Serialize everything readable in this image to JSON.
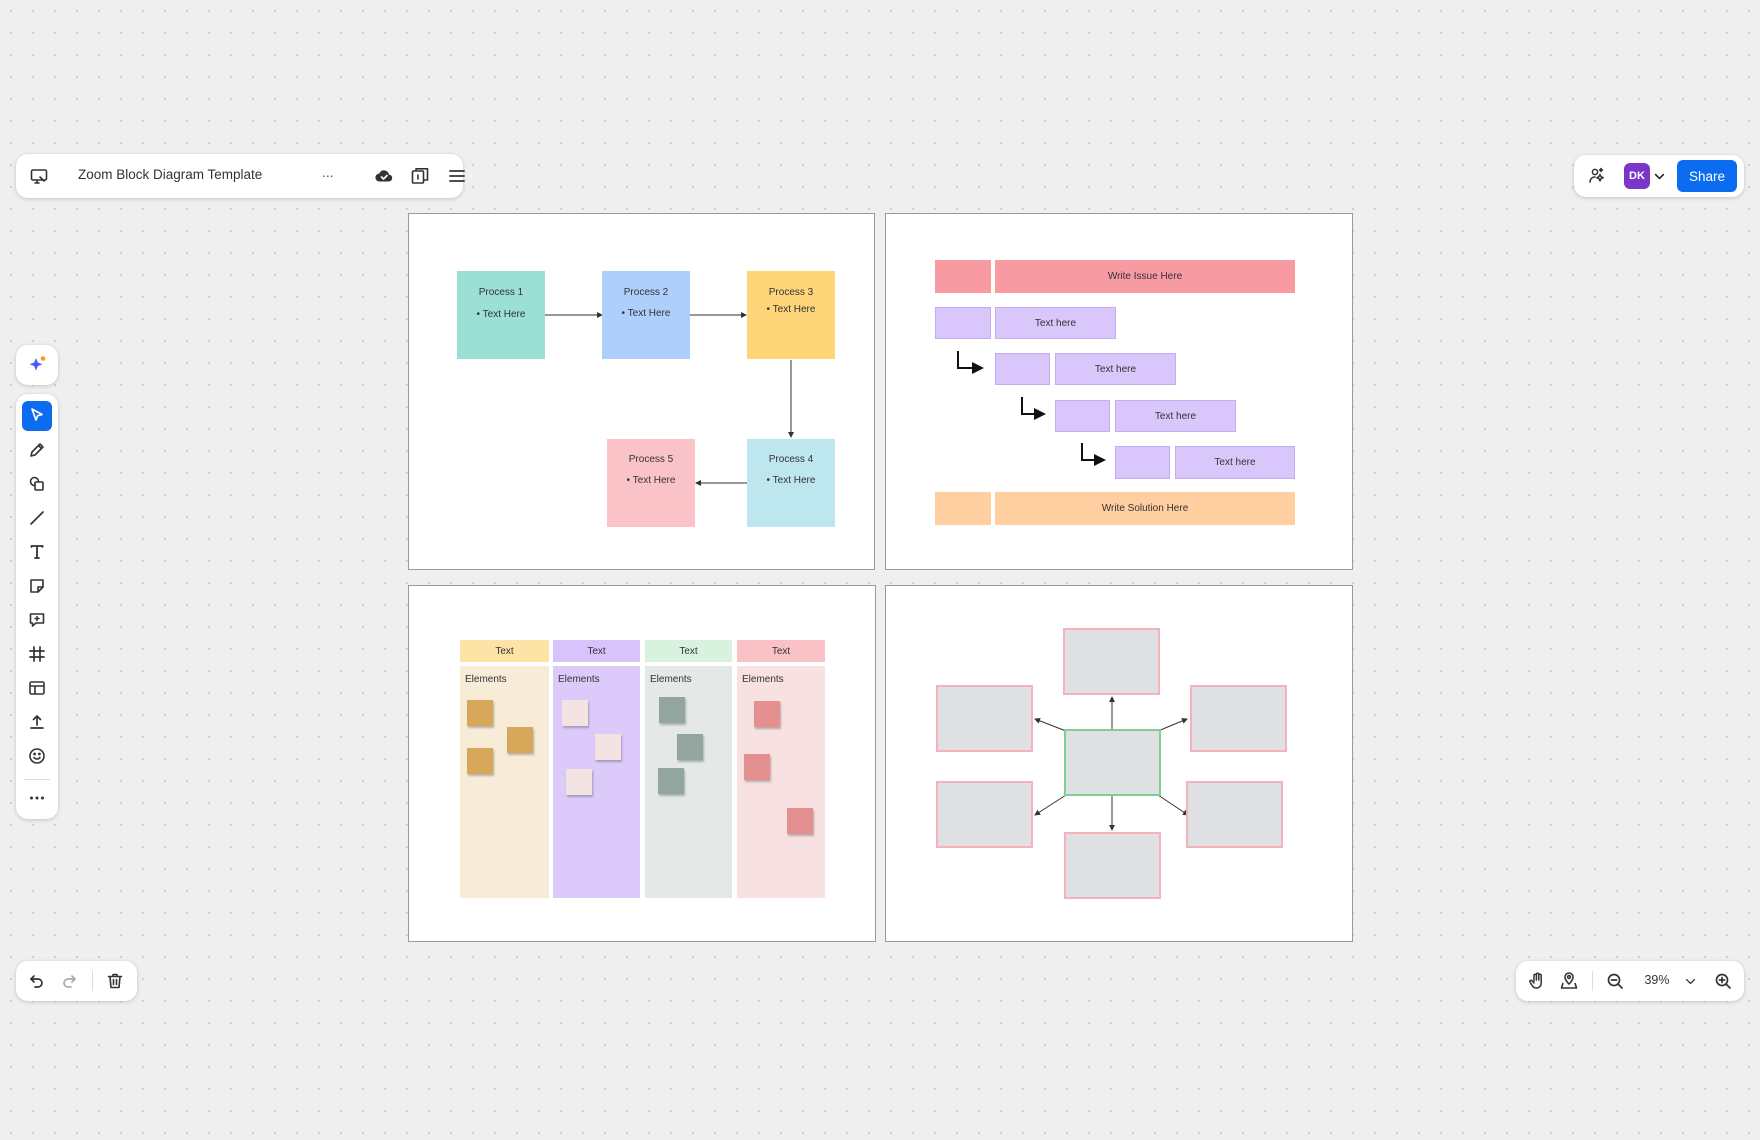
{
  "header": {
    "title": "Zoom Block Diagram Template",
    "more_label": "...",
    "icons": [
      "whiteboard-icon",
      "cloud-saved-icon",
      "page-view-icon",
      "menu-icon"
    ]
  },
  "top_right": {
    "avatar_initials": "DK",
    "share_label": "Share",
    "avatar_color": "#7b35c9",
    "share_color": "#0b6cf0"
  },
  "toolbar": {
    "tools": [
      "ai-assistant",
      "select",
      "pen",
      "shapes",
      "line",
      "text",
      "sticky-note",
      "comment",
      "frame",
      "template",
      "upload",
      "reaction",
      "more"
    ]
  },
  "bottom_left": {
    "tools": [
      "undo",
      "redo",
      "delete"
    ]
  },
  "zoom": {
    "level": "39%"
  },
  "process_flow": {
    "boxes": [
      {
        "title": "Process 1",
        "bullet": "Text Here",
        "color": "#9bdfd5"
      },
      {
        "title": "Process 2",
        "bullet": "Text Here",
        "color": "#aecffc"
      },
      {
        "title": "Process 3",
        "bullet": "Text Here",
        "color": "#ffd57a"
      },
      {
        "title": "Process 4",
        "bullet": "Text Here",
        "color": "#bde6ee"
      },
      {
        "title": "Process 5",
        "bullet": "Text Here",
        "color": "#fac3c8"
      }
    ]
  },
  "issue_tree": {
    "issue": "Write Issue Here",
    "steps": [
      "Text here",
      "Text here",
      "Text here",
      "Text here"
    ],
    "solution": "Write Solution  Here",
    "colors": {
      "issue": "#f89aa1",
      "step": "#d9c6fa",
      "solution": "#ffcfa1"
    }
  },
  "kanban": {
    "columns": [
      {
        "header": "Text",
        "label": "Elements",
        "header_color": "#fde4a6",
        "body_color": "#f8ecd8",
        "sticky_color": "#d8a85a"
      },
      {
        "header": "Text",
        "label": "Elements",
        "header_color": "#d8c4fb",
        "body_color": "#dccbfa",
        "sticky_color": "#f3e3e3"
      },
      {
        "header": "Text",
        "label": "Elements",
        "header_color": "#d9f1df",
        "body_color": "#e4e8e6",
        "sticky_color": "#92a69e"
      },
      {
        "header": "Text",
        "label": "Elements",
        "header_color": "#fac2c7",
        "body_color": "#f8e1e1",
        "sticky_color": "#e49090"
      }
    ]
  },
  "hub_diagram": {
    "center_border": "#7fd08f",
    "node_border": "#f4b3bb",
    "node_fill": "#dfe0e4"
  }
}
